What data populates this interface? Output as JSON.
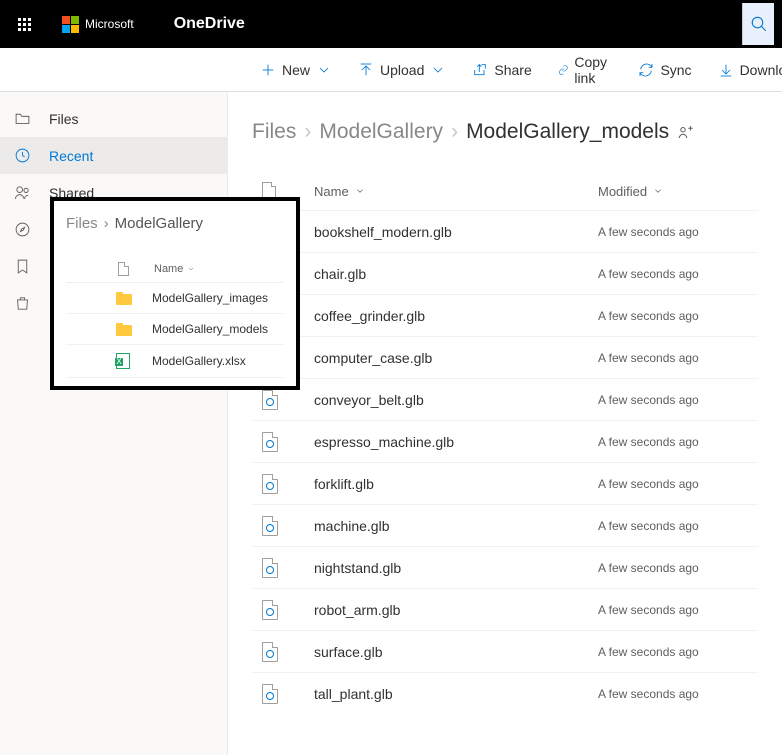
{
  "brand": {
    "company": "Microsoft",
    "app": "OneDrive"
  },
  "search": {
    "placeholder": "Search"
  },
  "toolbar": {
    "new_label": "New",
    "upload_label": "Upload",
    "share_label": "Share",
    "copy_link_label": "Copy link",
    "sync_label": "Sync",
    "download_label": "Download"
  },
  "sidebar": {
    "files": "Files",
    "recent": "Recent",
    "shared": "Shared"
  },
  "inset": {
    "crumb_root": "Files",
    "crumb_current": "ModelGallery",
    "col_name": "Name",
    "items": [
      {
        "name": "ModelGallery_images",
        "type": "folder"
      },
      {
        "name": "ModelGallery_models",
        "type": "folder"
      },
      {
        "name": "ModelGallery.xlsx",
        "type": "xlsx"
      }
    ]
  },
  "breadcrumb": {
    "root": "Files",
    "mid": "ModelGallery",
    "current": "ModelGallery_models"
  },
  "table": {
    "col_name": "Name",
    "col_modified": "Modified",
    "rows": [
      {
        "name": "bookshelf_modern.glb",
        "modified": "A few seconds ago"
      },
      {
        "name": "chair.glb",
        "modified": "A few seconds ago"
      },
      {
        "name": "coffee_grinder.glb",
        "modified": "A few seconds ago"
      },
      {
        "name": "computer_case.glb",
        "modified": "A few seconds ago"
      },
      {
        "name": "conveyor_belt.glb",
        "modified": "A few seconds ago"
      },
      {
        "name": "espresso_machine.glb",
        "modified": "A few seconds ago"
      },
      {
        "name": "forklift.glb",
        "modified": "A few seconds ago"
      },
      {
        "name": "machine.glb",
        "modified": "A few seconds ago"
      },
      {
        "name": "nightstand.glb",
        "modified": "A few seconds ago"
      },
      {
        "name": "robot_arm.glb",
        "modified": "A few seconds ago"
      },
      {
        "name": "surface.glb",
        "modified": "A few seconds ago"
      },
      {
        "name": "tall_plant.glb",
        "modified": "A few seconds ago"
      }
    ]
  }
}
